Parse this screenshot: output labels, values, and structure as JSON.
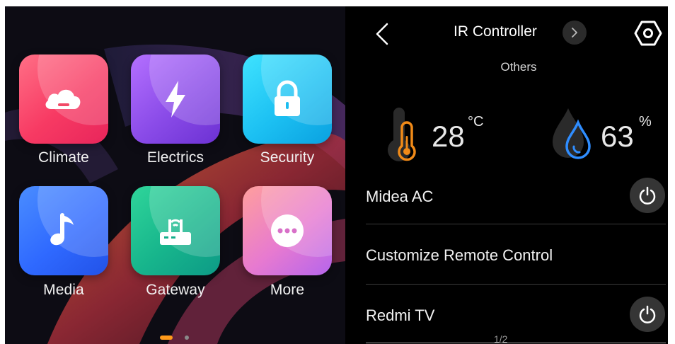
{
  "launcher": {
    "tiles": [
      {
        "label": "Climate",
        "icon": "cloud-icon"
      },
      {
        "label": "Electrics",
        "icon": "lightning-icon"
      },
      {
        "label": "Security",
        "icon": "lock-icon"
      },
      {
        "label": "Media",
        "icon": "music-note-icon"
      },
      {
        "label": "Gateway",
        "icon": "router-icon"
      },
      {
        "label": "More",
        "icon": "more-dots-icon"
      }
    ],
    "page_dots": {
      "count": 2,
      "active": 1
    }
  },
  "ir_panel": {
    "title": "IR Controller",
    "room": "Others",
    "temperature": {
      "value": "28",
      "unit": "°C"
    },
    "humidity": {
      "value": "63",
      "unit": "%"
    },
    "devices": [
      {
        "name": "Midea AC",
        "has_power": true
      },
      {
        "name": "Customize Remote Control",
        "has_power": false
      },
      {
        "name": "Redmi TV",
        "has_power": true
      }
    ],
    "page_indicator": "1/2"
  },
  "colors": {
    "accent_orange": "#ff9a1a",
    "thermo_orange": "#f08a18",
    "drop_blue": "#2f8dff"
  }
}
